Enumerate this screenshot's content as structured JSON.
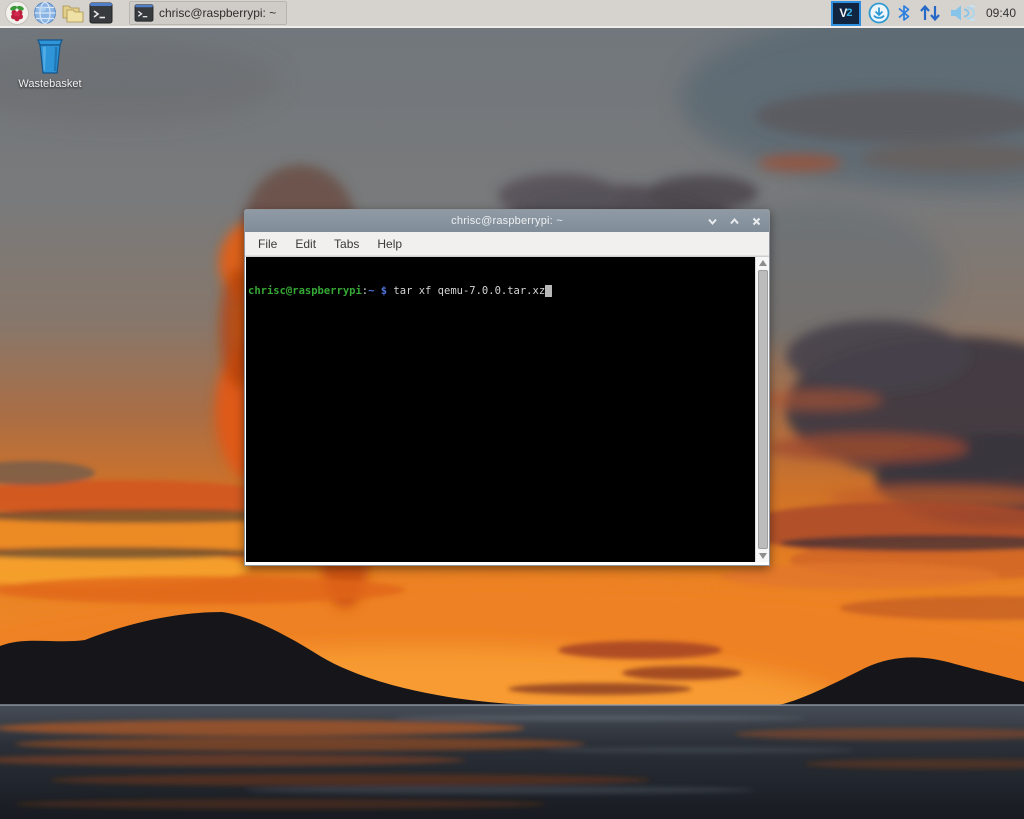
{
  "taskbar": {
    "task_button_label": "chrisc@raspberrypi: ~",
    "clock": "09:40",
    "vnc": {
      "part1": "V",
      "part2": "2"
    },
    "icons": [
      "raspberry-menu",
      "web-browser-globe",
      "file-manager-folders",
      "terminal",
      "vnc",
      "updater-download",
      "bluetooth",
      "network-up-down-arrows",
      "volume"
    ]
  },
  "desktop": {
    "wastebasket_label": "Wastebasket"
  },
  "terminal_window": {
    "title": "chrisc@raspberrypi: ~",
    "menu_items": [
      "File",
      "Edit",
      "Tabs",
      "Help"
    ],
    "prompt": {
      "user_host": "chrisc@raspberrypi",
      "colon": ":",
      "path": "~",
      "dollar": " $ "
    },
    "command": "tar xf qemu-7.0.0.tar.xz"
  },
  "colors": {
    "panel_bg": "#d6d3ce",
    "titlebar": "#87929d",
    "accent_blue": "#2e8fe0",
    "prompt_green": "#35a835",
    "prompt_blue": "#4f74d8",
    "terminal_fg": "#d4d4d4",
    "terminal_bg": "#000000"
  }
}
